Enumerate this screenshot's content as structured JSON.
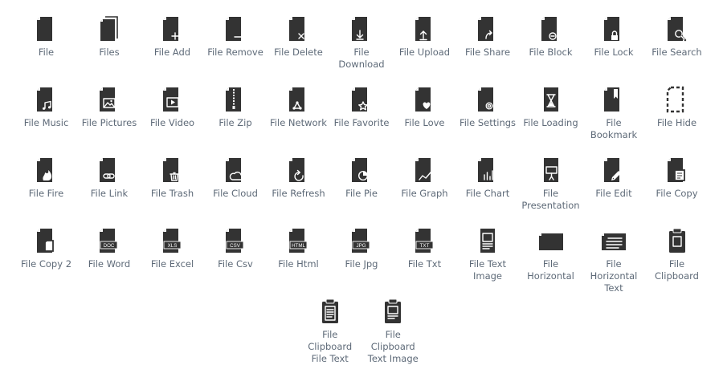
{
  "colors": {
    "icon": "#333333",
    "label": "#5e6a78",
    "background": "#ffffff"
  },
  "icons": [
    {
      "label": "File",
      "icon": "file-icon",
      "badge": "none"
    },
    {
      "label": "Files",
      "icon": "files-icon",
      "badge": "stack"
    },
    {
      "label": "File Add",
      "icon": "file-add-icon",
      "badge": "plus"
    },
    {
      "label": "File Remove",
      "icon": "file-remove-icon",
      "badge": "minus"
    },
    {
      "label": "File Delete",
      "icon": "file-delete-icon",
      "badge": "x"
    },
    {
      "label": "File Download",
      "icon": "file-download-icon",
      "badge": "down"
    },
    {
      "label": "File Upload",
      "icon": "file-upload-icon",
      "badge": "up"
    },
    {
      "label": "File Share",
      "icon": "file-share-icon",
      "badge": "share"
    },
    {
      "label": "File Block",
      "icon": "file-block-icon",
      "badge": "block"
    },
    {
      "label": "File Lock",
      "icon": "file-lock-icon",
      "badge": "lock"
    },
    {
      "label": "File Search",
      "icon": "file-search-icon",
      "badge": "search"
    },
    {
      "label": "File Music",
      "icon": "file-music-icon",
      "badge": "music"
    },
    {
      "label": "File Pictures",
      "icon": "file-pictures-icon",
      "badge": "pictures"
    },
    {
      "label": "File Video",
      "icon": "file-video-icon",
      "badge": "video"
    },
    {
      "label": "File Zip",
      "icon": "file-zip-icon",
      "badge": "zip"
    },
    {
      "label": "File Network",
      "icon": "file-network-icon",
      "badge": "network"
    },
    {
      "label": "File Favorite",
      "icon": "file-favorite-icon",
      "badge": "star"
    },
    {
      "label": "File Love",
      "icon": "file-love-icon",
      "badge": "heart"
    },
    {
      "label": "File Settings",
      "icon": "file-settings-icon",
      "badge": "gear"
    },
    {
      "label": "File Loading",
      "icon": "file-loading-icon",
      "badge": "hourglass"
    },
    {
      "label": "File Bookmark",
      "icon": "file-bookmark-icon",
      "badge": "bookmark"
    },
    {
      "label": "File Hide",
      "icon": "file-hide-icon",
      "badge": "hide"
    },
    {
      "label": "File Fire",
      "icon": "file-fire-icon",
      "badge": "fire"
    },
    {
      "label": "File Link",
      "icon": "file-link-icon",
      "badge": "link"
    },
    {
      "label": "File Trash",
      "icon": "file-trash-icon",
      "badge": "trash"
    },
    {
      "label": "File Cloud",
      "icon": "file-cloud-icon",
      "badge": "cloud"
    },
    {
      "label": "File Refresh",
      "icon": "file-refresh-icon",
      "badge": "refresh"
    },
    {
      "label": "File Pie",
      "icon": "file-pie-icon",
      "badge": "pie"
    },
    {
      "label": "File Graph",
      "icon": "file-graph-icon",
      "badge": "graph"
    },
    {
      "label": "File Chart",
      "icon": "file-chart-icon",
      "badge": "chart"
    },
    {
      "label": "File Presentation",
      "icon": "file-presentation-icon",
      "badge": "presentation"
    },
    {
      "label": "File Edit",
      "icon": "file-edit-icon",
      "badge": "pencil"
    },
    {
      "label": "File Copy",
      "icon": "file-copy-icon",
      "badge": "copy"
    },
    {
      "label": "File Copy 2",
      "icon": "file-copy-2-icon",
      "badge": "copy2"
    },
    {
      "label": "File Word",
      "icon": "file-word-icon",
      "badge": "tag",
      "tag": "DOC"
    },
    {
      "label": "File Excel",
      "icon": "file-excel-icon",
      "badge": "tag",
      "tag": "XLS"
    },
    {
      "label": "File Csv",
      "icon": "file-csv-icon",
      "badge": "tag",
      "tag": "CSV"
    },
    {
      "label": "File Html",
      "icon": "file-html-icon",
      "badge": "tag",
      "tag": "HTML"
    },
    {
      "label": "File Jpg",
      "icon": "file-jpg-icon",
      "badge": "tag",
      "tag": "JPG"
    },
    {
      "label": "File Txt",
      "icon": "file-txt-icon",
      "badge": "tag",
      "tag": "TXT"
    },
    {
      "label": "File Text Image",
      "icon": "file-text-image-icon",
      "badge": "textimage"
    },
    {
      "label": "File Horizontal",
      "icon": "file-horizontal-icon",
      "badge": "horizontal"
    },
    {
      "label": "File Horizontal Text",
      "icon": "file-horizontal-text-icon",
      "badge": "horizontaltext"
    },
    {
      "label": "File Clipboard",
      "icon": "file-clipboard-icon",
      "badge": "clipboard"
    },
    {
      "label": "File Clipboard File Text",
      "icon": "file-clipboard-file-text-icon",
      "badge": "clipboardtext"
    },
    {
      "label": "File Clipboard Text Image",
      "icon": "file-clipboard-text-image-icon",
      "badge": "clipboardimage"
    }
  ]
}
